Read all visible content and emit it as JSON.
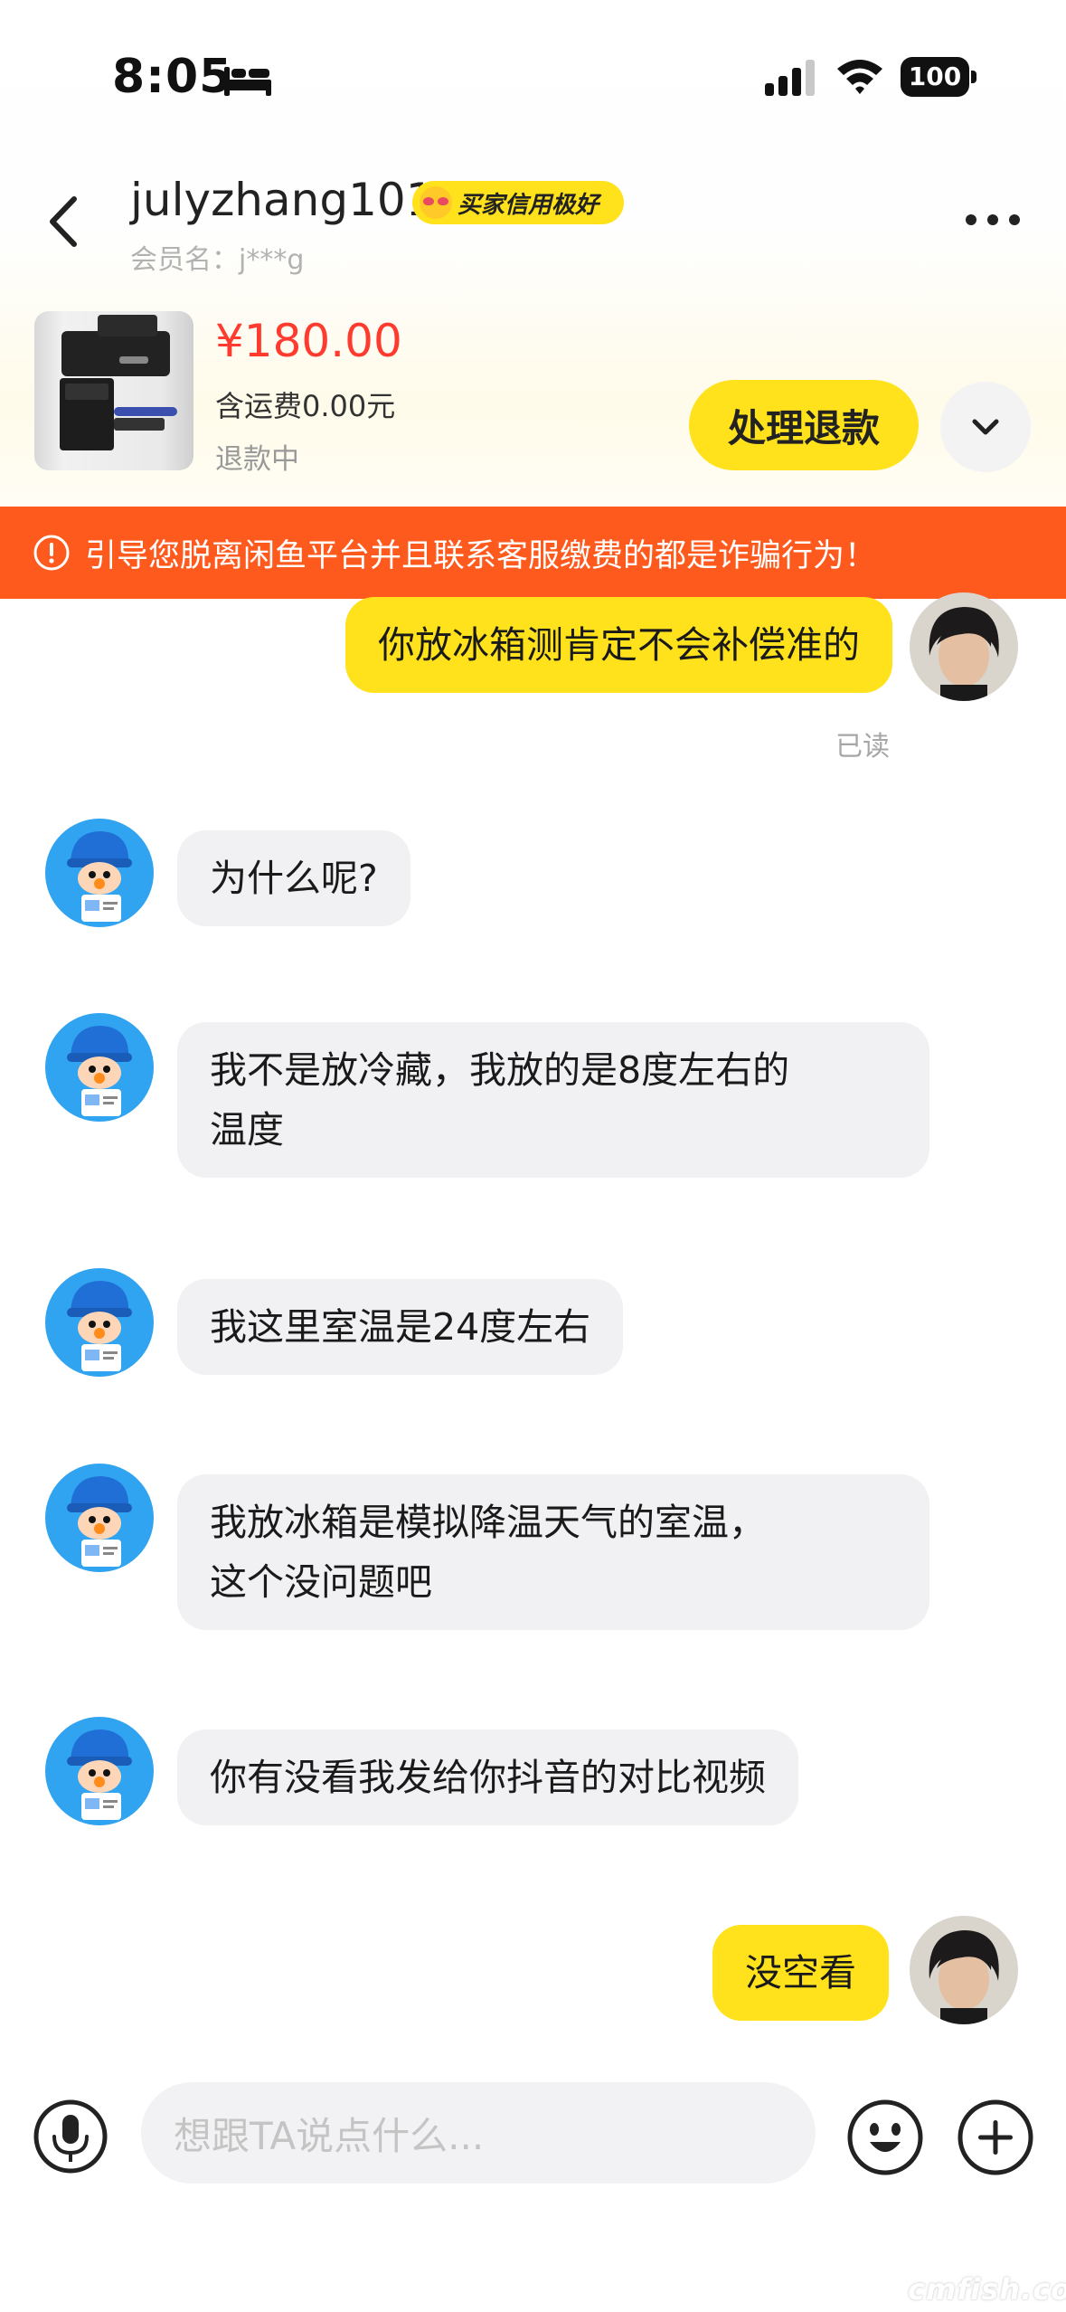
{
  "status_bar": {
    "time": "8:05",
    "battery": "100"
  },
  "header": {
    "username": "julyzhang101",
    "credit_badge": "买家信用极好",
    "member_label": "会员名：j***g"
  },
  "product": {
    "price": "¥180.00",
    "shipping": "含运费0.00元",
    "status": "退款中",
    "action_label": "处理退款"
  },
  "warning_text": "引导您脱离闲鱼平台并且联系客服缴费的都是诈骗行为！",
  "messages": [
    {
      "from": "me",
      "lines": [
        "你放冰箱测肯定不会补偿准的"
      ]
    },
    {
      "from": "them",
      "lines": [
        "为什么呢?"
      ]
    },
    {
      "from": "them",
      "lines": [
        "我不是放冷藏，我放的是8度左右的",
        "温度"
      ]
    },
    {
      "from": "them",
      "lines": [
        "我这里室温是24度左右"
      ]
    },
    {
      "from": "them",
      "lines": [
        "我放冰箱是模拟降温天气的室温，",
        "这个没问题吧"
      ]
    },
    {
      "from": "them",
      "lines": [
        "你有没看我发给你抖音的对比视频"
      ]
    },
    {
      "from": "me",
      "lines": [
        "没空看"
      ]
    }
  ],
  "read_label": "已读",
  "input": {
    "placeholder": "想跟TA说点什么..."
  },
  "watermark": "cmfish.com",
  "colors": {
    "accent_yellow": "#ffe21c",
    "warning_orange": "#ff5a1e",
    "price_red": "#ff3b30"
  },
  "icons": [
    "back-icon",
    "more-icon",
    "chevron-down-icon",
    "alert-icon",
    "mic-icon",
    "emoji-icon",
    "plus-icon"
  ]
}
